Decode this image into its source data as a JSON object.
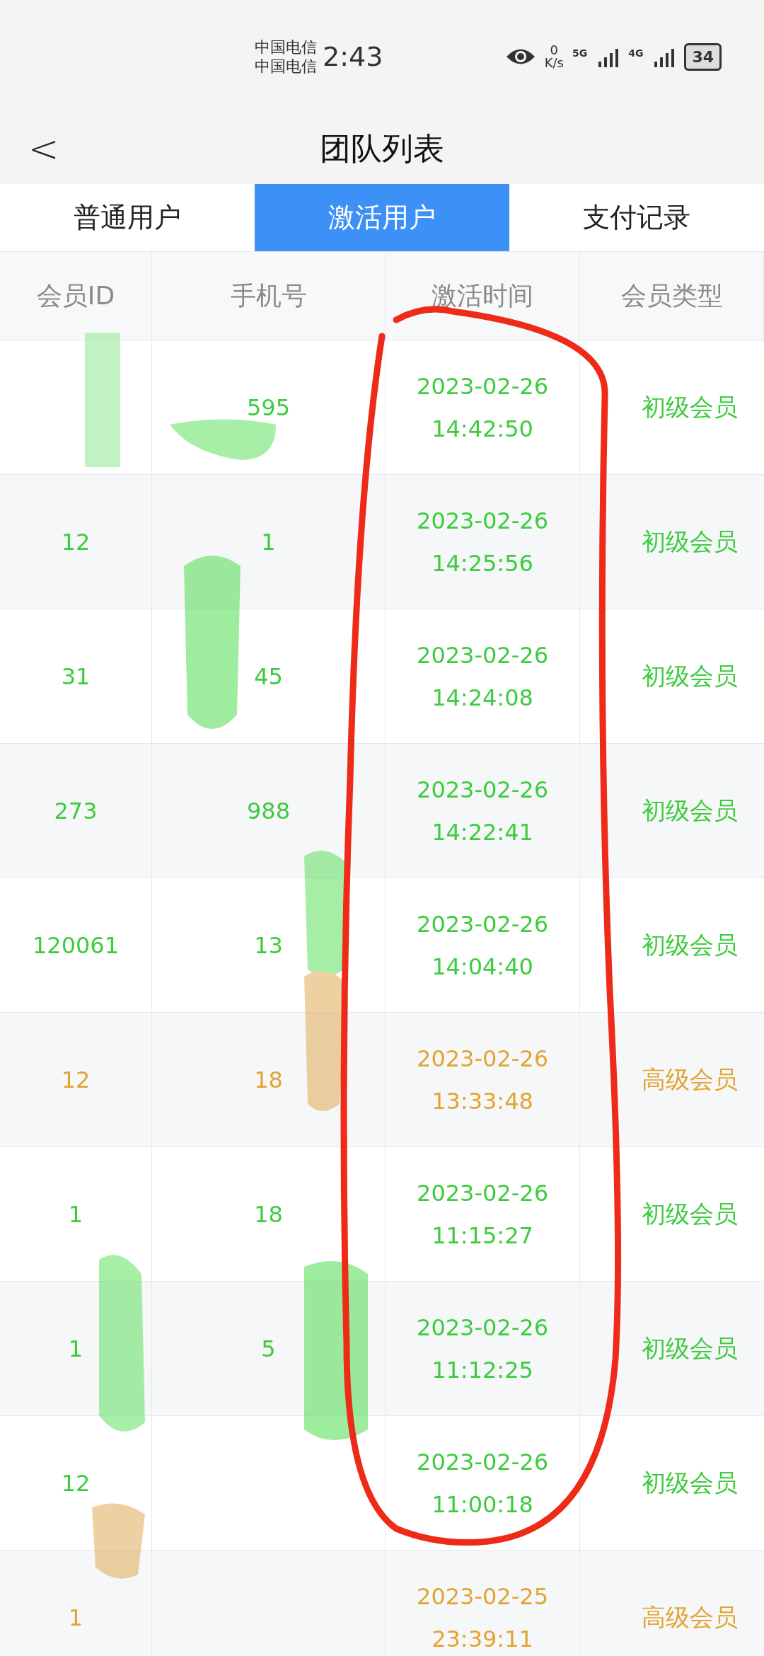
{
  "status_bar": {
    "carriers": [
      "中国电信",
      "中国电信"
    ],
    "time": "2:43",
    "speed_value": "0",
    "speed_unit": "K/s",
    "network_1": "5G",
    "network_2": "4G",
    "battery": "34"
  },
  "header": {
    "back": "<",
    "title": "团队列表"
  },
  "tabs": [
    {
      "label": "普通用户",
      "selected": false
    },
    {
      "label": "激活用户",
      "selected": true
    },
    {
      "label": "支付记录",
      "selected": false
    }
  ],
  "table": {
    "columns": [
      "会员ID",
      "手机号",
      "激活时间",
      "会员类型"
    ],
    "rows": [
      {
        "member_id": "",
        "phone": "595",
        "date": "2023-02-26",
        "time": "14:42:50",
        "type": "初级会员",
        "color": "#3dcc3d"
      },
      {
        "member_id": "12",
        "phone": "1",
        "date": "2023-02-26",
        "time": "14:25:56",
        "type": "初级会员",
        "color": "#3dcc3d"
      },
      {
        "member_id": "31",
        "phone": "45",
        "date": "2023-02-26",
        "time": "14:24:08",
        "type": "初级会员",
        "color": "#3dcc3d"
      },
      {
        "member_id": "273",
        "phone": "988",
        "date": "2023-02-26",
        "time": "14:22:41",
        "type": "初级会员",
        "color": "#3dcc3d"
      },
      {
        "member_id": "120061",
        "phone": "13",
        "date": "2023-02-26",
        "time": "14:04:40",
        "type": "初级会员",
        "color": "#3dcc3d"
      },
      {
        "member_id": "12",
        "phone": "18",
        "date": "2023-02-26",
        "time": "13:33:48",
        "type": "高级会员",
        "color": "#e3a431"
      },
      {
        "member_id": "1",
        "phone": "18",
        "date": "2023-02-26",
        "time": "11:15:27",
        "type": "初级会员",
        "color": "#3dcc3d"
      },
      {
        "member_id": "1",
        "phone": "5",
        "date": "2023-02-26",
        "time": "11:12:25",
        "type": "初级会员",
        "color": "#3dcc3d"
      },
      {
        "member_id": "12",
        "phone": "",
        "date": "2023-02-26",
        "time": "11:00:18",
        "type": "初级会员",
        "color": "#3dcc3d"
      },
      {
        "member_id": "1",
        "phone": "",
        "date": "2023-02-25",
        "time": "23:39:11",
        "type": "高级会员",
        "color": "#e3a431"
      }
    ]
  }
}
